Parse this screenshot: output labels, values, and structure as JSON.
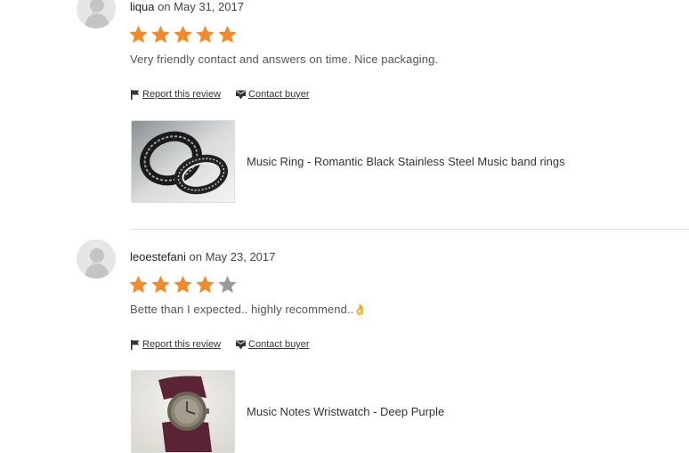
{
  "reviews": [
    {
      "username": "liqua",
      "date_text": "on May 31, 2017",
      "rating": 5,
      "rating_max": 5,
      "text": "Very friendly contact and answers on time. Nice packaging.",
      "product_title": "Music Ring - Romantic Black Stainless Steel Music band rings"
    },
    {
      "username": "leoestefani",
      "date_text": "on May 23, 2017",
      "rating": 4,
      "rating_max": 5,
      "text": "Bette than I expected.. highly recommend..",
      "emoji": "👌",
      "product_title": "Music Notes Wristwatch - Deep Purple"
    }
  ],
  "actions": {
    "report": "Report this review",
    "contact": "Contact buyer"
  },
  "icons": {
    "report": "flag-icon",
    "contact": "envelope-icon",
    "star": "star-icon",
    "avatar": "default-avatar-icon"
  },
  "colors": {
    "star_filled": "#f1892d",
    "star_empty": "#9b9b9b"
  }
}
